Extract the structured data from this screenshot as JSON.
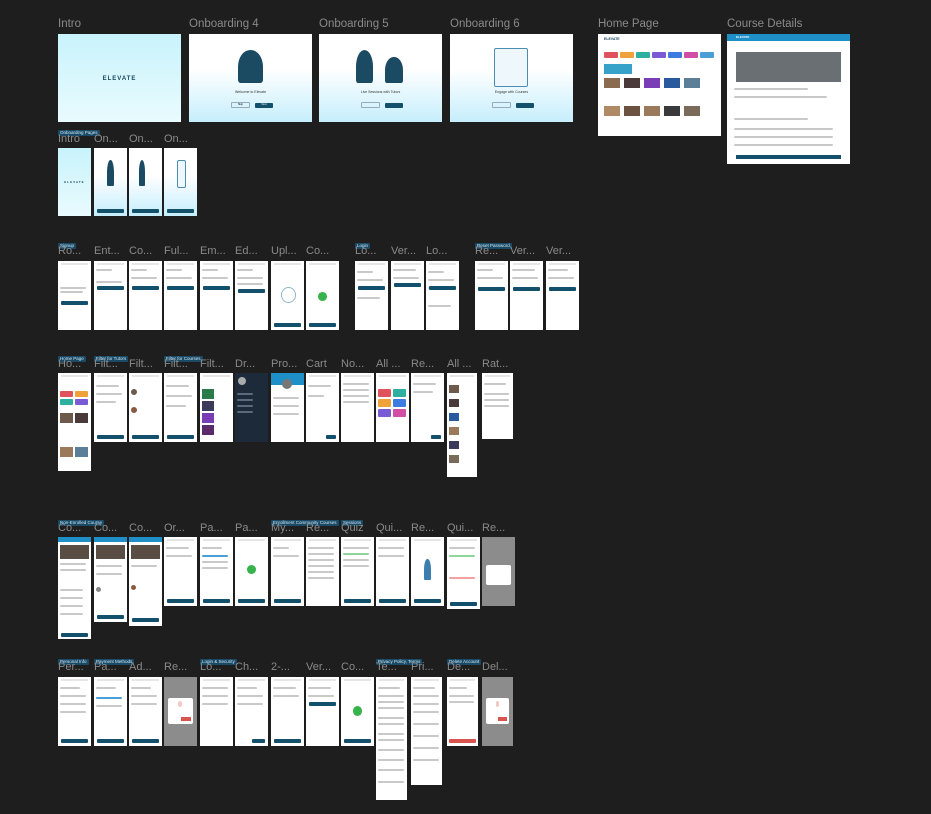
{
  "canvas": {
    "background": "#1e1e1e",
    "frame_color": "#ffffff",
    "accent": "#12506b",
    "tag_color": "#1a4a66"
  },
  "row1": {
    "intro": "Intro",
    "onb4": "Onboarding 4",
    "onb5": "Onboarding 5",
    "onb6": "Onboarding 6",
    "home": "Home Page",
    "course": "Course Details",
    "intro_logo": "ELEVATE",
    "onb4_text": "Welcome to Elevate",
    "onb5_text": "Live Sessions with Tutors",
    "onb6_text": "Engage with Courses",
    "skip": "Skip",
    "next": "Next",
    "home_logo": "ELEVATE",
    "course_header": "ELEVATE"
  },
  "row2": {
    "tag": "Onboarding Pages",
    "labels": [
      "Intro",
      "On...",
      "On...",
      "On..."
    ],
    "logo": "ELEVATE"
  },
  "row3": {
    "tags": [
      "Signup",
      "Login",
      "Reset Password"
    ],
    "labels": [
      "Ro...",
      "Ent...",
      "Co...",
      "Ful...",
      "Em...",
      "Ed...",
      "Upl...",
      "Co...",
      "Lo...",
      "Ver...",
      "Lo...",
      "Re...",
      "Ver...",
      "Ver..."
    ]
  },
  "row4": {
    "tags": [
      "Home Page",
      "Filter for Tutors",
      "Filter for Courses"
    ],
    "labels": [
      "Ho...",
      "Filt...",
      "Filt...",
      "Filt...",
      "Filt...",
      "Dr...",
      "Pro...",
      "Cart",
      "No...",
      "All ...",
      "Re...",
      "All ...",
      "Rat..."
    ]
  },
  "row5": {
    "tags": [
      "Non-Enrolled Course",
      "Enrollment Community Courses",
      "Sessions"
    ],
    "labels": [
      "Co...",
      "Co...",
      "Co...",
      "Or...",
      "Pa...",
      "Pa...",
      "My...",
      "Re...",
      "Quiz",
      "Qui...",
      "Re...",
      "Qui...",
      "Re..."
    ]
  },
  "row6": {
    "tags": [
      "Personal Info",
      "Payment Methods",
      "Login & Security",
      "Privacy Policy, Terms",
      "Delete Account"
    ],
    "labels": [
      "Per...",
      "Pa...",
      "Ad...",
      "Re...",
      "Lo...",
      "Ch...",
      "2-...",
      "Ver...",
      "Co...",
      "Te...",
      "Pri...",
      "De...",
      "Del..."
    ]
  }
}
